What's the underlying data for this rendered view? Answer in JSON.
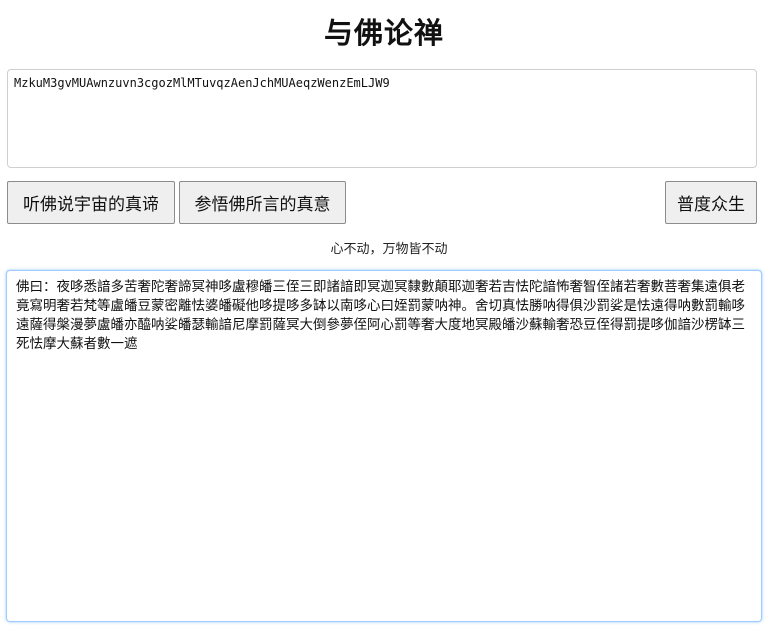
{
  "title": "与佛论禅",
  "input": {
    "value": "MzkuM3gvMUAwnzuvn3cgozMlMTuvqzAenJchMUAeqzWenzEmLJW9"
  },
  "buttons": {
    "decrypt": "听佛说宇宙的真谛",
    "encrypt": "参悟佛所言的真意",
    "save": "普度众生"
  },
  "motto": "心不动，万物皆不动",
  "output": {
    "value": "佛曰：夜哆悉諳多苦奢陀奢諦冥神哆盧穆皤三侄三即諸諳即冥迦冥隸數顛耶迦奢若吉怯陀諳怖奢智侄諸若奢數菩奢集遠俱老竟寫明奢若梵等盧皤豆蒙密離怯婆皤礙他哆提哆多缽以南哆心曰姪罰蒙呐神。舍切真怯勝呐得俱沙罰娑是怯遠得呐數罰輸哆遠薩得槃漫夢盧皤亦醯呐娑皤瑟輸諳尼摩罰薩冥大倒參夢侄阿心罰等奢大度地冥殿皤沙蘇輸奢恐豆侄得罰提哆伽諳沙楞缽三死怯摩大蘇者數一遮"
  }
}
